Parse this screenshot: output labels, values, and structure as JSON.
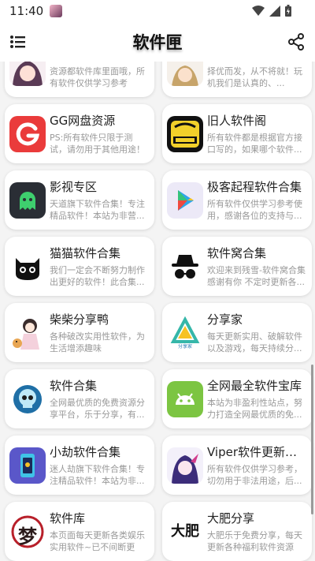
{
  "status": {
    "time": "11:40"
  },
  "app": {
    "title": "软件匣"
  },
  "cards": [
    {
      "title": "",
      "desc": "资源都软件库里面哦，所有软件仅供学习参考",
      "icon": "anime-girl-icon"
    },
    {
      "title": "",
      "desc": "择优而发，从不将就！玩机我们是认真的、...",
      "icon": "anime-character-icon"
    },
    {
      "title": "GG网盘资源",
      "desc": "PS:所有软件只限于测试，请勿用于其他用途！如...",
      "icon": "g-letter-icon"
    },
    {
      "title": "旧人软件阁",
      "desc": "所有软件都是根据官方接口写的，如果哪个软件...",
      "icon": "old-people-badge-icon"
    },
    {
      "title": "影视专区",
      "desc": "天道旗下软件合集！专注精品软件！本站为非营...",
      "icon": "ghost-icon"
    },
    {
      "title": "极客起程软件合集",
      "desc": "所有软件仅供学习参考使用，感谢各位的支持与...",
      "icon": "play-store-icon"
    },
    {
      "title": "猫猫软件合集",
      "desc": "我们一定会不断努力制作出更好的软件！此合集...",
      "icon": "black-cat-icon"
    },
    {
      "title": "软件窝合集",
      "desc": "欢迎来到残雪-软件窝合集感谢有你 不定时更新各...",
      "icon": "incognito-icon"
    },
    {
      "title": "柴柴分享鸭",
      "desc": "各种破改实用性软件，为生活增添趣味",
      "icon": "girl-with-dog-icon"
    },
    {
      "title": "分享家",
      "desc": "每天更新实用、破解软件以及游戏，每天持续分...",
      "icon": "share-home-logo-icon",
      "logo_text": "分享家"
    },
    {
      "title": "软件合集",
      "desc": "全网最优质的免费资源分享平台，乐于分享，有...",
      "icon": "skull-icon"
    },
    {
      "title": "全网最全软件宝库",
      "desc": "本站为非盈利性站点，努力打造全网最优质的免...",
      "icon": "android-icon"
    },
    {
      "title": "小劫软件合集",
      "desc": "迷人劫旗下软件合集！专注精品软件！本站为非...",
      "icon": "phone-app-icon"
    },
    {
      "title": "Viper软件更新合...",
      "desc": "所有软件仅供学习参考，切勿用于非法用途，后...",
      "icon": "anime-purple-girl-icon"
    },
    {
      "title": "软件库",
      "desc": "本页面每天更新各类娱乐实用软件~已不间断更新...",
      "icon": "calligraphy-meng-icon",
      "logo_text": "梦"
    },
    {
      "title": "大肥分享",
      "desc": "大肥乐于免费分享，每天更新各种福利软件资源",
      "icon": "calligraphy-dafei-icon",
      "logo_text": "大肥"
    }
  ]
}
